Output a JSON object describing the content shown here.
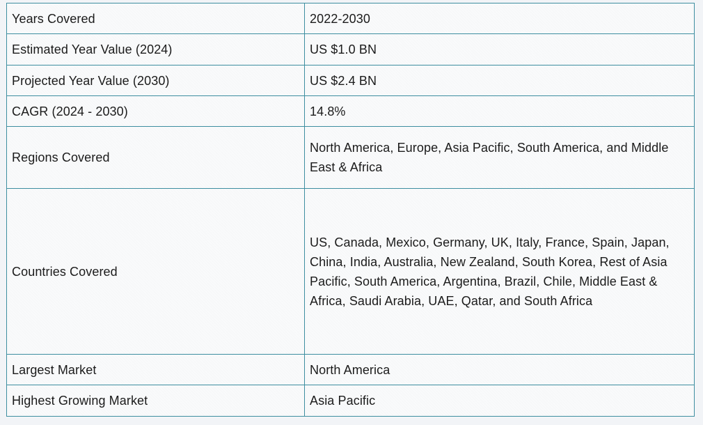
{
  "rows": [
    {
      "label": "Years Covered",
      "value": "2022-2030"
    },
    {
      "label": "Estimated Year Value (2024)",
      "value": "US $1.0 BN"
    },
    {
      "label": "Projected Year Value (2030)",
      "value": "US $2.4 BN"
    },
    {
      "label": "CAGR (2024 - 2030)",
      "value": "14.8%"
    },
    {
      "label": "Regions Covered",
      "value": "North America, Europe, Asia Pacific, South America, and Middle East & Africa"
    },
    {
      "label": "Countries Covered",
      "value": "US, Canada, Mexico, Germany, UK, Italy, France, Spain, Japan, China, India, Australia, New Zealand, South Korea, Rest of Asia Pacific, South America, Argentina, Brazil, Chile, Middle East & Africa, Saudi Arabia, UAE, Qatar, and South Africa"
    },
    {
      "label": "Largest Market",
      "value": "North America"
    },
    {
      "label": "Highest Growing Market",
      "value": "Asia Pacific"
    }
  ]
}
